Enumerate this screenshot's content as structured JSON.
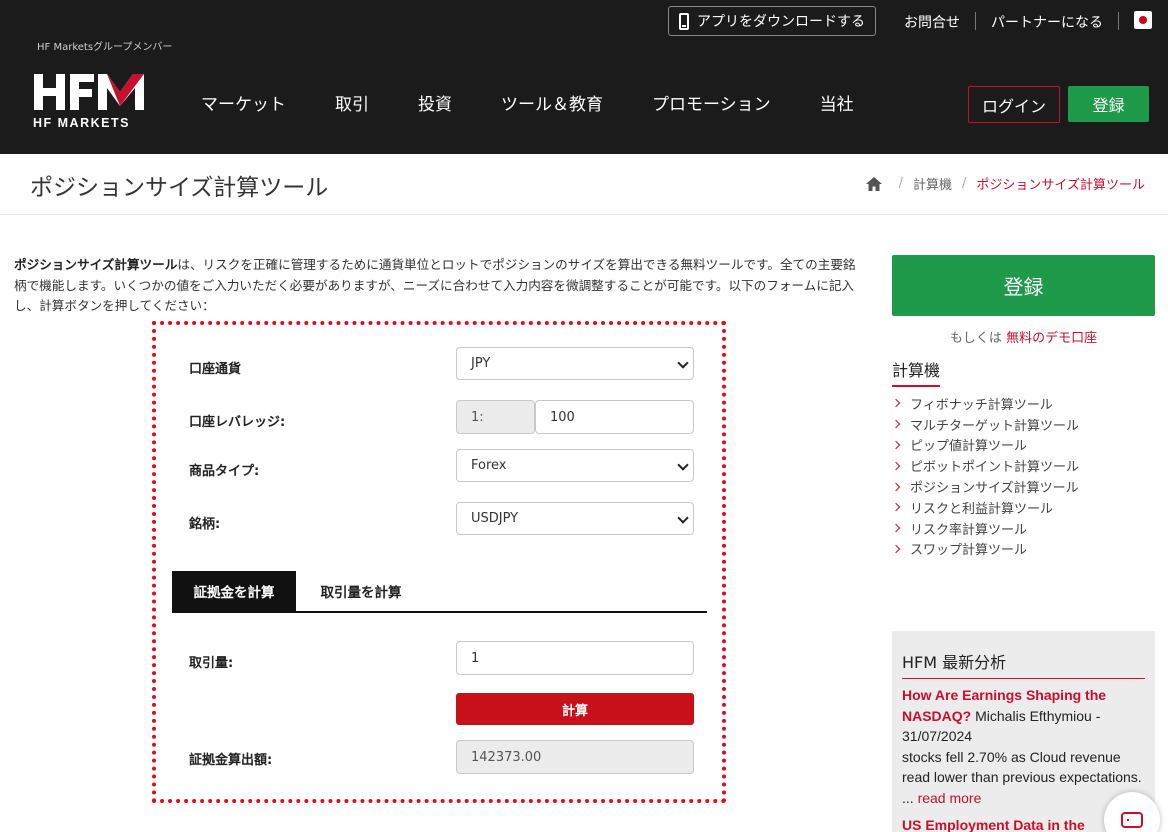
{
  "header": {
    "group_member": "HF Marketsグループメンバー",
    "logo_text": "HFM",
    "logo_sub": "HF MARKETS",
    "app_button": "アプリをダウンロードする",
    "contact": "お問合せ",
    "partner": "パートナーになる",
    "nav": [
      "マーケット",
      "取引",
      "投資",
      "ツール＆教育",
      "プロモーション",
      "当社"
    ],
    "login": "ログイン",
    "register": "登録"
  },
  "title_bar": {
    "title": "ポジションサイズ計算ツール",
    "breadcrumb": [
      "計算機",
      "ポジションサイズ計算ツール"
    ]
  },
  "intro": {
    "bold": "ポジションサイズ計算ツール",
    "text": "は、リスクを正確に管理するために通貨単位とロットでポジションのサイズを算出できる無料ツールです。全ての主要銘柄で機能します。いくつかの値をご入力いただく必要がありますが、ニーズに合わせて入力内容を微調整することが可能です。以下のフォームに記入し、計算ボタンを押してください："
  },
  "calculator": {
    "account_currency_label": "口座通貨",
    "account_currency_value": "JPY",
    "leverage_label": "口座レバレッジ:",
    "leverage_prefix": "1:",
    "leverage_value": "100",
    "product_type_label": "商品タイプ:",
    "product_type_value": "Forex",
    "symbol_label": "銘柄:",
    "symbol_value": "USDJPY",
    "tabs": [
      "証拠金を計算",
      "取引量を計算"
    ],
    "volume_label": "取引量:",
    "volume_value": "1",
    "calc_button": "計算",
    "result_label": "証拠金算出額:",
    "result_value": "142373.00"
  },
  "sidebar": {
    "register": "登録",
    "or_text": "もしくは",
    "demo_link": "無料のデモ口座",
    "heading": "計算機",
    "links": [
      "フィボナッチ計算ツール",
      "マルチターゲット計算ツール",
      "ピップ値計算ツール",
      "ピボットポイント計算ツール",
      "ポジションサイズ計算ツール",
      "リスクと利益計算ツール",
      "リスク率計算ツール",
      "スワップ計算ツール"
    ],
    "news": {
      "title": "HFM 最新分析",
      "headline": "How Are Earnings Shaping the NASDAQ?",
      "byline": " Michalis Efthymiou - 31/07/2024",
      "snippet": "stocks fell 2.70% as Cloud revenue read lower than previous expectations. ... ",
      "read_more": "read more",
      "second_headline": "US Employment Data in the"
    }
  },
  "colors": {
    "brand_red": "#c8102e",
    "brand_green": "#1e9a4a",
    "header_bg": "#1b1b1b"
  }
}
